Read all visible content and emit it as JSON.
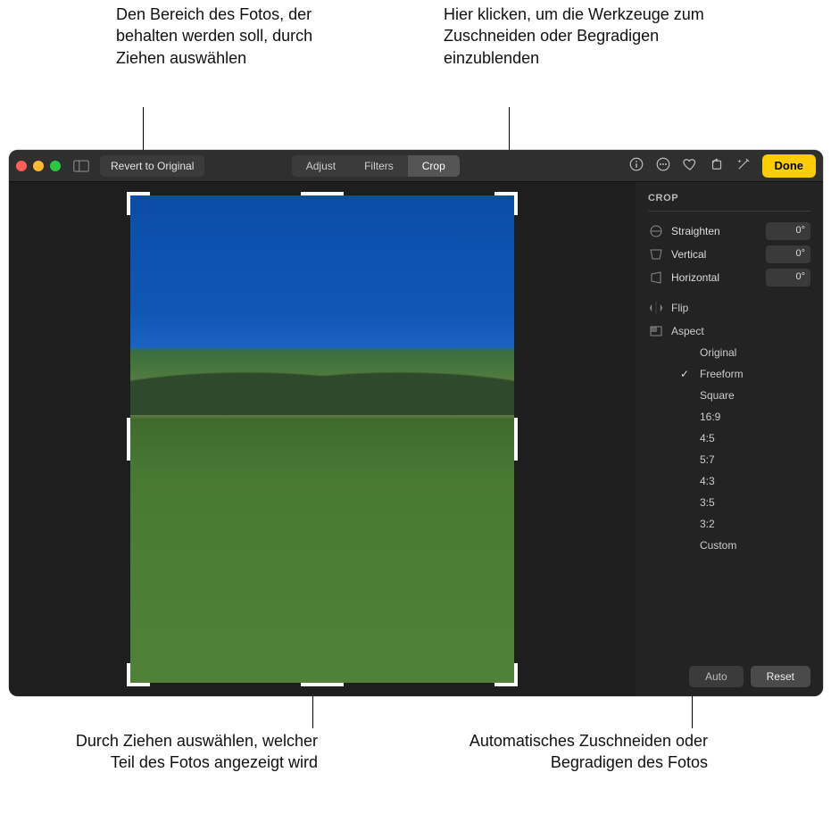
{
  "callouts": {
    "top_left": "Den Bereich des Fotos, der behalten werden soll, durch Ziehen auswählen",
    "top_right": "Hier klicken, um die Werkzeuge zum Zuschneiden oder Begradigen einzublenden",
    "bottom_left": "Durch Ziehen auswählen, welcher Teil des Fotos angezeigt wird",
    "bottom_right": "Automatisches Zuschneiden oder Begradigen des Fotos"
  },
  "toolbar": {
    "revert": "Revert to Original",
    "adjust": "Adjust",
    "filters": "Filters",
    "crop": "Crop",
    "done": "Done"
  },
  "sidebar": {
    "title": "CROP",
    "straighten": {
      "label": "Straighten",
      "value": "0°"
    },
    "vertical": {
      "label": "Vertical",
      "value": "0°"
    },
    "horizontal": {
      "label": "Horizontal",
      "value": "0°"
    },
    "flip": "Flip",
    "aspect": "Aspect",
    "options": [
      "Original",
      "Freeform",
      "Square",
      "16:9",
      "4:5",
      "5:7",
      "4:3",
      "3:5",
      "3:2",
      "Custom"
    ],
    "selected": "Freeform",
    "auto": "Auto",
    "reset": "Reset"
  }
}
